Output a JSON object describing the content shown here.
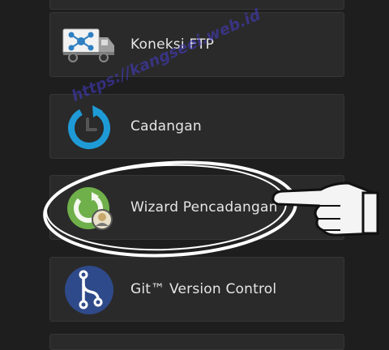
{
  "items": [
    {
      "label": "Koneksi FTP",
      "icon": "ftp-truck-icon"
    },
    {
      "label": "Cadangan",
      "icon": "backup-clock-icon"
    },
    {
      "label": "Wizard Pencadangan",
      "icon": "backup-wizard-icon"
    },
    {
      "label": "Git™ Version Control",
      "icon": "git-branch-icon"
    }
  ],
  "watermark": "https://kangseei.web.id",
  "annotation": {
    "shape": "ellipse-highlight",
    "pointer": "pointing-hand-icon",
    "color": "#ffffff"
  },
  "colors": {
    "background": "#1e1e1e",
    "tile": "#2a2a2a",
    "backup_blue": "#1e9bd7",
    "wizard_green": "#6fb04a",
    "git_navy": "#2f4a8a"
  }
}
